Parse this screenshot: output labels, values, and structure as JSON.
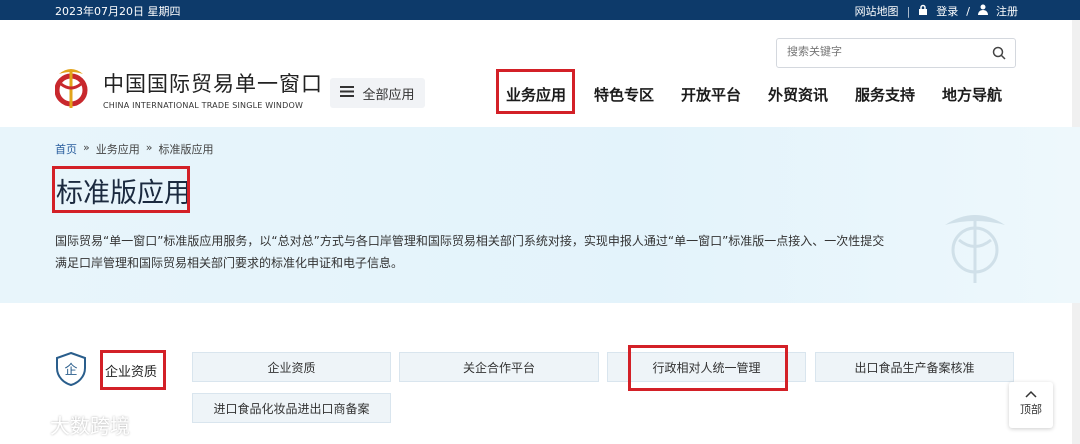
{
  "topbar": {
    "date": "2023年07月20日 星期四",
    "sitemap": "网站地图",
    "login": "登录",
    "slash": "/",
    "register": "注册"
  },
  "brand": {
    "name_cn": "中国国际贸易单一窗口",
    "name_en": "CHINA INTERNATIONAL TRADE SINGLE WINDOW"
  },
  "all_apps": "全部应用",
  "search": {
    "placeholder": "搜索关键字"
  },
  "nav": [
    "业务应用",
    "特色专区",
    "开放平台",
    "外贸资讯",
    "服务支持",
    "地方导航"
  ],
  "breadcrumb": {
    "home": "首页",
    "sep": "»",
    "level1": "业务应用",
    "current": "标准版应用"
  },
  "page_title": "标准版应用",
  "description": "国际贸易“单一窗口”标准版应用服务，以“总对总”方式与各口岸管理和国际贸易相关部门系统对接，实现申报人通过“单一窗口”标准版一点接入、一次性提交满足口岸管理和国际贸易相关部门要求的标准化申证和电子信息。",
  "category": {
    "icon_char": "企",
    "label": "企业资质"
  },
  "tiles": [
    "企业资质",
    "关企合作平台",
    "行政相对人统一管理",
    "出口食品生产备案核准",
    "进口食品化妆品进出口商备案"
  ],
  "to_top": "顶部",
  "watermark": "大数跨境",
  "colors": {
    "topbar": "#0d3a6a",
    "highlight": "#d32027",
    "banner": "#e6f4fb"
  }
}
